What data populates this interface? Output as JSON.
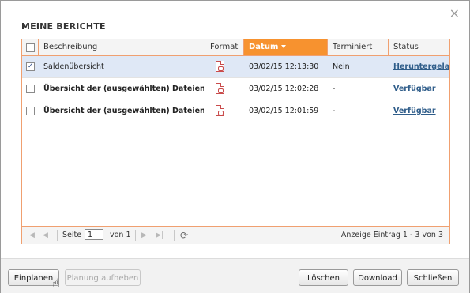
{
  "dialog": {
    "title": "MEINE BERICHTE",
    "close_glyph": "×"
  },
  "table": {
    "columns": {
      "beschreibung": "Beschreibung",
      "format": "Format",
      "datum": "Datum",
      "terminiert": "Terminiert",
      "status": "Status"
    },
    "sort_column": "Datum",
    "rows": [
      {
        "selected": true,
        "beschreibung": "Saldenübersicht",
        "format_icon": "pdf-icon",
        "datum": "03/02/15 12:13:30",
        "terminiert": "Nein",
        "status": "Heruntergeladen"
      },
      {
        "selected": false,
        "beschreibung": "Übersicht der (ausgewählten) Dateien",
        "format_icon": "pdf-icon",
        "datum": "03/02/15 12:02:28",
        "terminiert": "-",
        "status": "Verfügbar"
      },
      {
        "selected": false,
        "beschreibung": "Übersicht der (ausgewählten) Dateien",
        "format_icon": "pdf-icon",
        "datum": "03/02/15 12:01:59",
        "terminiert": "-",
        "status": "Verfügbar"
      }
    ]
  },
  "pager": {
    "page_label": "Seite",
    "page_value": "1",
    "of_label": "von 1",
    "summary": "Anzeige Eintrag 1 - 3 von 3"
  },
  "footer": {
    "einplanen": "Einplanen",
    "planung_aufheben": "Planung aufheben",
    "loeschen": "Löschen",
    "download": "Download",
    "schliessen": "Schließen"
  },
  "colors": {
    "accent": "#f7922f",
    "grid_border": "#f0a070",
    "selected_row": "#dfe8f6",
    "link": "#2f5d8a"
  }
}
